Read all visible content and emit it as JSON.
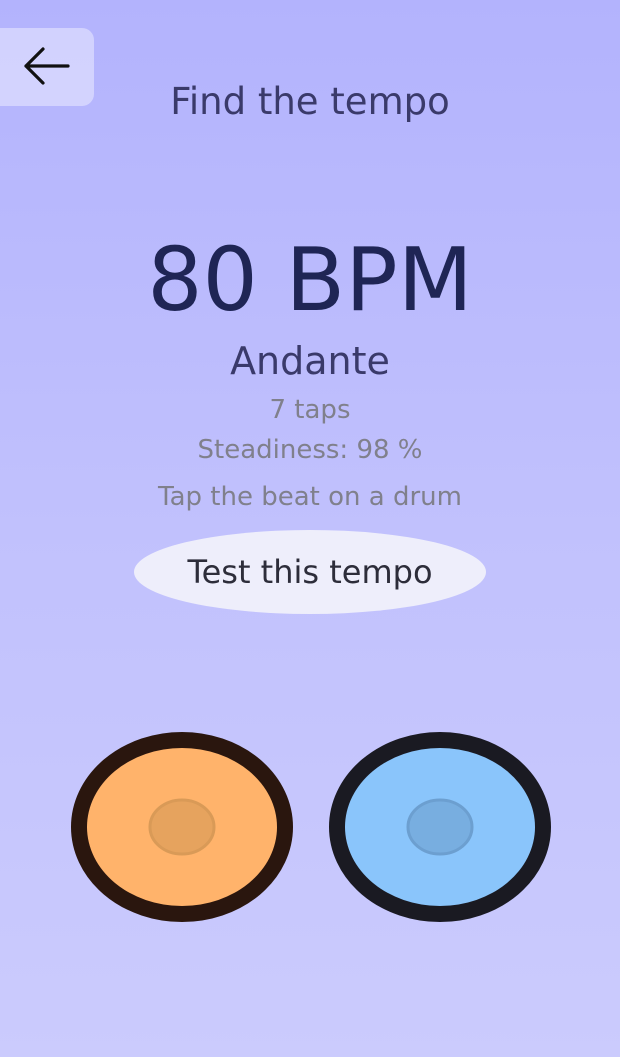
{
  "header": {
    "back_icon": "arrow-left-icon",
    "title": "Find the tempo"
  },
  "tempo": {
    "bpm_text": "80 BPM",
    "bpm": 80,
    "name": "Andante",
    "taps_text": "7 taps",
    "steadiness_text": "Steadiness: 98 %",
    "hint": "Tap the beat on a drum"
  },
  "actions": {
    "test_label": "Test this tempo"
  },
  "drums": [
    {
      "id": "left",
      "fill": "#ffb36b",
      "rim": "#2a160e",
      "center": "#e6a35e"
    },
    {
      "id": "right",
      "fill": "#8ac5fb",
      "rim": "#1a1a22",
      "center": "#78aee0"
    }
  ],
  "colors": {
    "background_top": "#b3b3fd",
    "background_bottom": "#cbcbfd",
    "text_primary": "#1f2555",
    "text_secondary": "#3a3a6a",
    "text_muted": "#80808c",
    "button_bg": "#eeeefb"
  }
}
